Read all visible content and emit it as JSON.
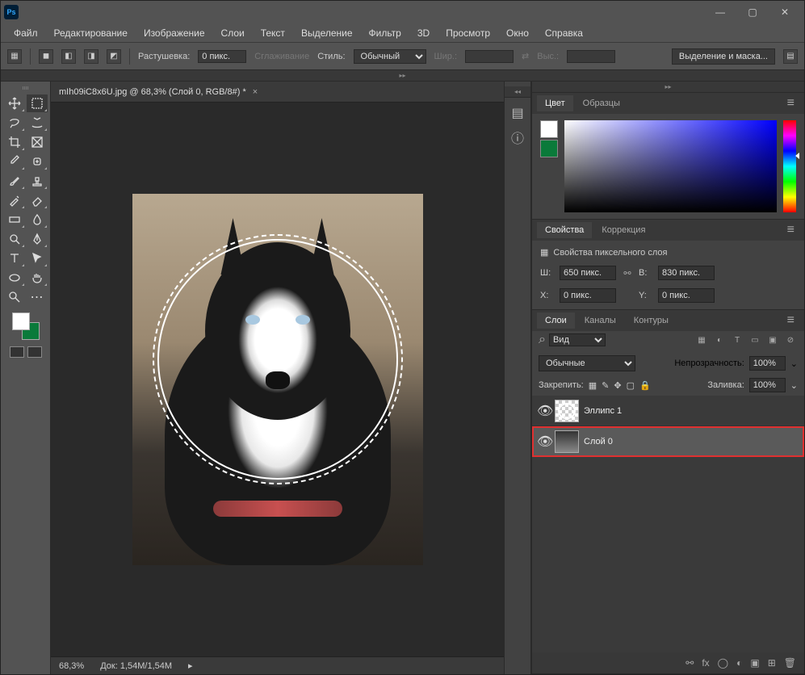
{
  "menubar": [
    "Файл",
    "Редактирование",
    "Изображение",
    "Слои",
    "Текст",
    "Выделение",
    "Фильтр",
    "3D",
    "Просмотр",
    "Окно",
    "Справка"
  ],
  "options": {
    "feather_label": "Растушевка:",
    "feather_value": "0 пикс.",
    "antialias": "Сглаживание",
    "style_label": "Стиль:",
    "style_value": "Обычный",
    "width_label": "Шир.:",
    "height_label": "Выс.:",
    "select_mask": "Выделение и маска..."
  },
  "doc": {
    "tab": "mIh09iC8x6U.jpg @ 68,3% (Слой 0, RGB/8#) *",
    "zoom": "68,3%",
    "docsize_label": "Док:",
    "docsize": "1,54M/1,54M"
  },
  "panels": {
    "color_tab": "Цвет",
    "swatches_tab": "Образцы",
    "properties_tab": "Свойства",
    "adjustments_tab": "Коррекция",
    "layers_tab": "Слои",
    "channels_tab": "Каналы",
    "paths_tab": "Контуры"
  },
  "properties": {
    "title": "Свойства пиксельного слоя",
    "w_label": "Ш:",
    "w_value": "650 пикс.",
    "h_label": "В:",
    "h_value": "830 пикс.",
    "x_label": "X:",
    "x_value": "0 пикс.",
    "y_label": "Y:",
    "y_value": "0 пикс."
  },
  "layers": {
    "filter_label": "Вид",
    "blend_mode": "Обычные",
    "opacity_label": "Непрозрачность:",
    "opacity_value": "100%",
    "lock_label": "Закрепить:",
    "fill_label": "Заливка:",
    "fill_value": "100%",
    "items": [
      {
        "name": "Эллипс 1",
        "selected": false,
        "type": "shape"
      },
      {
        "name": "Слой 0",
        "selected": true,
        "type": "image"
      }
    ]
  }
}
